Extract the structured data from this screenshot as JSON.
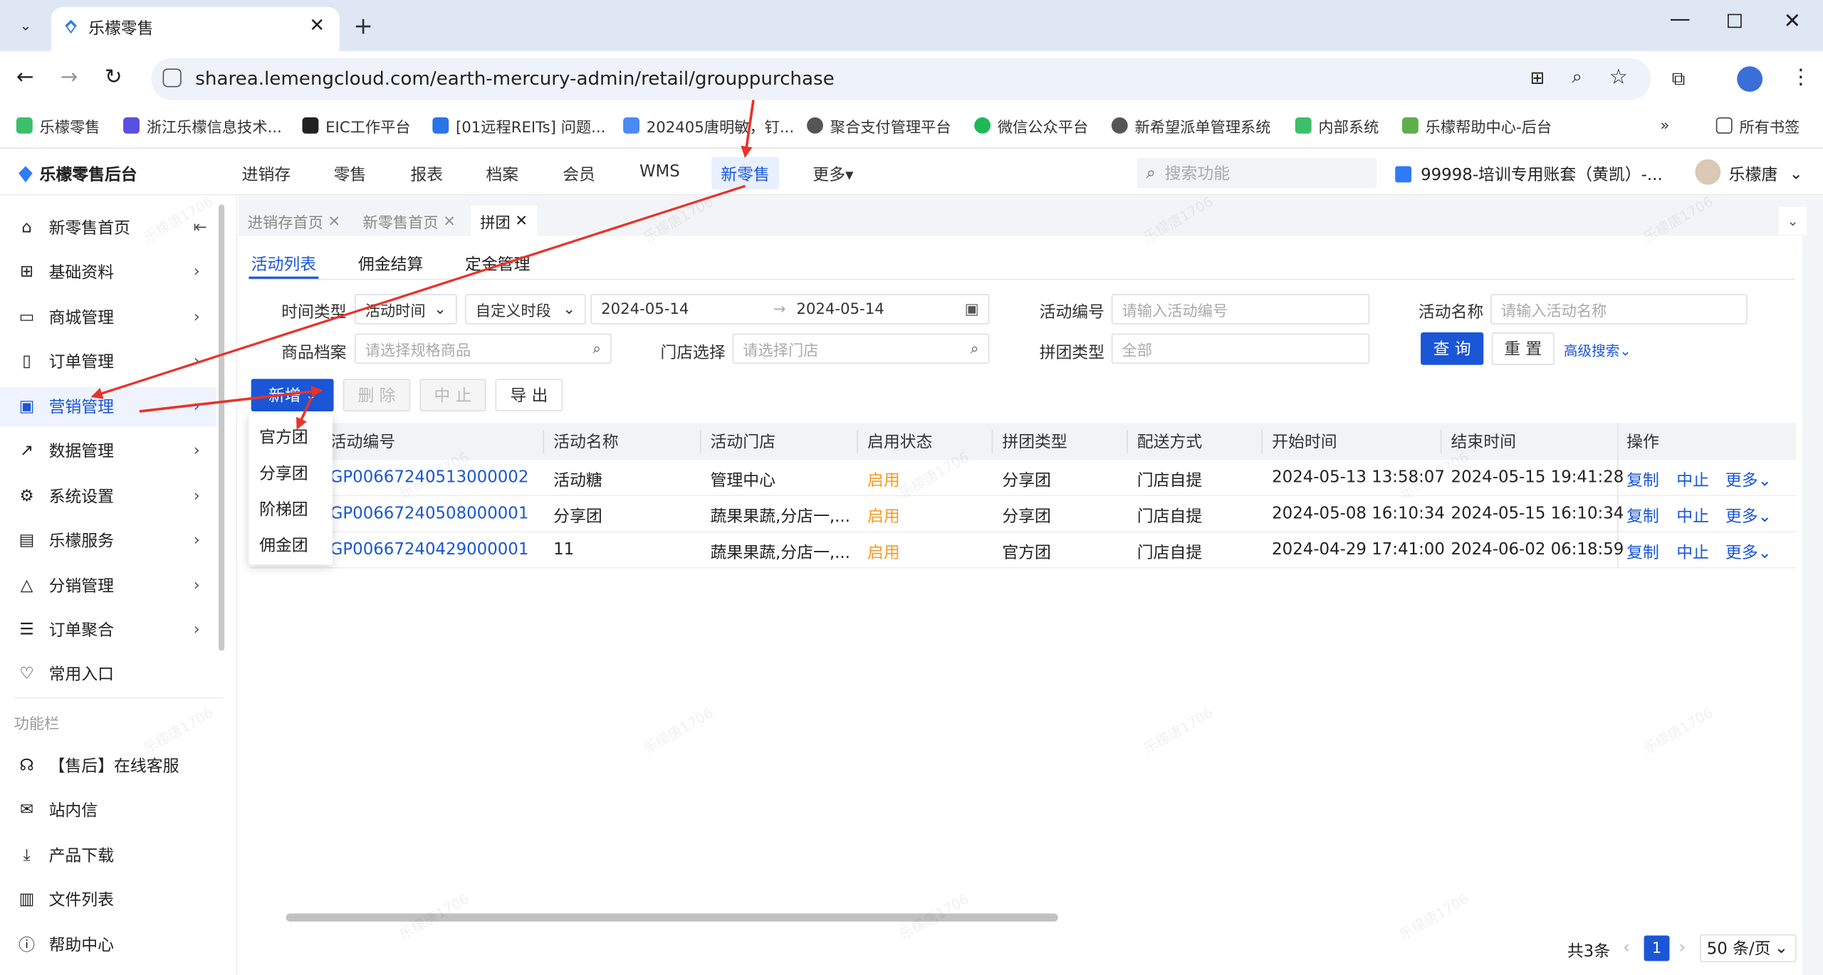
{
  "browser": {
    "tab_title": "乐檬零售",
    "url": "sharea.lemengcloud.com/earth-mercury-admin/retail/grouppurchase",
    "bookmarks": [
      "乐檬零售",
      "浙江乐檬信息技术...",
      "EIC工作平台",
      "[01远程REITs] 问题...",
      "202405唐明敏，钉...",
      "聚合支付管理平台",
      "微信公众平台",
      "新希望派单管理系统",
      "内部系统",
      "乐檬帮助中心-后台"
    ],
    "all_bookmarks": "所有书签"
  },
  "app": {
    "logo": "乐檬零售后台",
    "nav": [
      "进销存",
      "零售",
      "报表",
      "档案",
      "会员",
      "WMS",
      "新零售",
      "更多"
    ],
    "active_nav": "新零售",
    "search_placeholder": "搜索功能",
    "account": "99998-培训专用账套（黄凯）-...",
    "user": "乐檬唐"
  },
  "sidebar": {
    "items": [
      "新零售首页",
      "基础资料",
      "商城管理",
      "订单管理",
      "营销管理",
      "数据管理",
      "系统设置",
      "乐檬服务",
      "分销管理",
      "订单聚合",
      "常用入口"
    ],
    "section": "功能栏",
    "func_items": [
      "【售后】在线客服",
      "站内信",
      "产品下载",
      "文件列表",
      "帮助中心"
    ]
  },
  "page_tabs": [
    "进销存首页",
    "新零售首页",
    "拼团"
  ],
  "sub_tabs": [
    "活动列表",
    "佣金结算",
    "定金管理"
  ],
  "filters": {
    "time_type_label": "时间类型",
    "time_type_value": "活动时间",
    "period_value": "自定义时段",
    "date_start": "2024-05-14",
    "date_end": "2024-05-14",
    "activity_no_label": "活动编号",
    "activity_no_placeholder": "请输入活动编号",
    "activity_name_label": "活动名称",
    "activity_name_placeholder": "请输入活动名称",
    "goods_label": "商品档案",
    "goods_placeholder": "请选择规格商品",
    "store_label": "门店选择",
    "store_placeholder": "请选择门店",
    "group_type_label": "拼团类型",
    "group_type_value": "全部",
    "query": "查 询",
    "reset": "重 置",
    "advanced": "高级搜索"
  },
  "actions": {
    "add": "新增",
    "delete": "删 除",
    "stop": "中 止",
    "export": "导 出"
  },
  "add_menu": [
    "官方团",
    "分享团",
    "阶梯团",
    "佣金团"
  ],
  "table": {
    "headers": [
      "活动编号",
      "活动名称",
      "活动门店",
      "启用状态",
      "拼团类型",
      "配送方式",
      "开始时间",
      "结束时间",
      "操作"
    ],
    "rows": [
      {
        "no": "GP00667240513000002",
        "name": "活动糖",
        "store": "管理中心",
        "status": "启用",
        "type": "分享团",
        "delivery": "门店自提",
        "start": "2024-05-13 13:58:07",
        "end": "2024-05-15 19:41:28"
      },
      {
        "no": "GP00667240508000001",
        "name": "分享团",
        "store": "蔬果果蔬,分店一,...",
        "status": "启用",
        "type": "分享团",
        "delivery": "门店自提",
        "start": "2024-05-08 16:10:34",
        "end": "2024-05-15 16:10:34"
      },
      {
        "no": "GP00667240429000001",
        "name": "11",
        "store": "蔬果果蔬,分店一,...",
        "status": "启用",
        "type": "官方团",
        "delivery": "门店自提",
        "start": "2024-04-29 17:41:00",
        "end": "2024-06-02 06:18:59"
      }
    ],
    "op_copy": "复制",
    "op_stop": "中止",
    "op_more": "更多"
  },
  "pagination": {
    "total": "共3条",
    "page": "1",
    "size": "50 条/页"
  },
  "watermark": "乐檬唐1706",
  "colors": {
    "primary": "#1a56d6",
    "annotation": "#e8332a",
    "status": "#f59a23"
  }
}
